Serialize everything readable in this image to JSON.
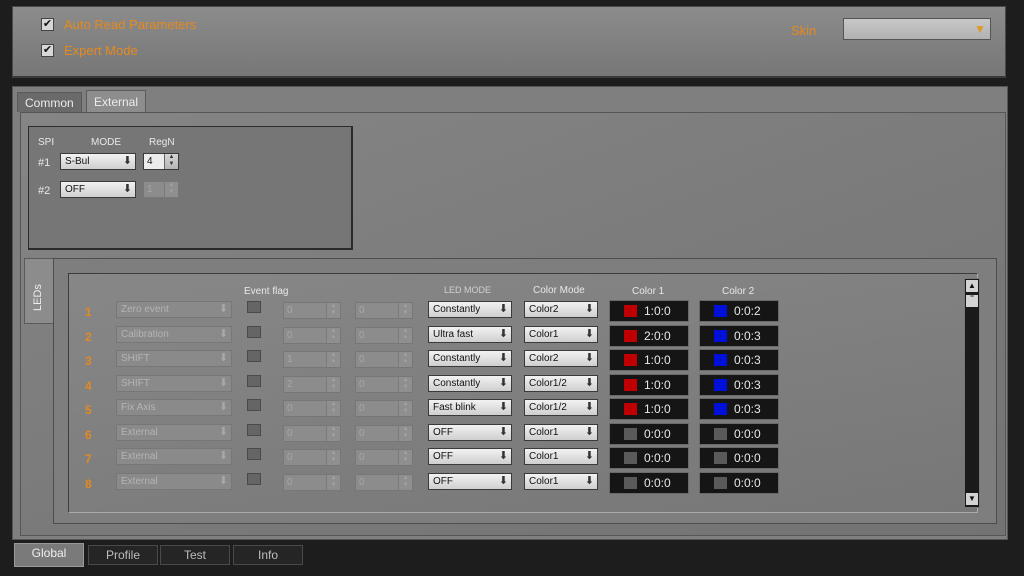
{
  "options": {
    "auto_read": {
      "label": "Auto Read Parameters",
      "checked": true
    },
    "expert_mode": {
      "label": "Expert Mode",
      "checked": true
    }
  },
  "skin": {
    "label": "Skin",
    "value": ""
  },
  "tabs": [
    {
      "label": "Common",
      "active": false
    },
    {
      "label": "External",
      "active": true
    }
  ],
  "spi": {
    "headers": {
      "spi": "SPI",
      "mode": "MODE",
      "regn": "RegN"
    },
    "rows": [
      {
        "label": "#1",
        "mode": "S-Bul",
        "regn": "4",
        "enabled": true
      },
      {
        "label": "#2",
        "mode": "OFF",
        "regn": "1",
        "enabled": false
      }
    ]
  },
  "leds": {
    "side_tab": "LEDs",
    "headers": {
      "event_flag": "Event flag",
      "led_mode": "LED MODE",
      "color_mode": "Color Mode",
      "color1": "Color 1",
      "color2": "Color 2"
    },
    "rows": [
      {
        "num": "1",
        "event": "Zero event",
        "v1": "0",
        "v2": "0",
        "led_mode": "Constantly",
        "color_mode": "Color2",
        "c1": "1:0:0",
        "c1_hex": "#c00000",
        "c2": "0:0:2",
        "c2_hex": "#0010d8"
      },
      {
        "num": "2",
        "event": "Calibration",
        "v1": "0",
        "v2": "0",
        "led_mode": "Ultra fast",
        "color_mode": "Color1",
        "c1": "2:0:0",
        "c1_hex": "#c00000",
        "c2": "0:0:3",
        "c2_hex": "#0010d8"
      },
      {
        "num": "3",
        "event": "SHIFT",
        "v1": "1",
        "v2": "0",
        "led_mode": "Constantly",
        "color_mode": "Color2",
        "c1": "1:0:0",
        "c1_hex": "#c00000",
        "c2": "0:0:3",
        "c2_hex": "#0010d8"
      },
      {
        "num": "4",
        "event": "SHIFT",
        "v1": "2",
        "v2": "0",
        "led_mode": "Constantly",
        "color_mode": "Color1/2",
        "c1": "1:0:0",
        "c1_hex": "#c00000",
        "c2": "0:0:3",
        "c2_hex": "#0010d8"
      },
      {
        "num": "5",
        "event": "Fix Axis",
        "v1": "0",
        "v2": "0",
        "led_mode": "Fast blink",
        "color_mode": "Color1/2",
        "c1": "1:0:0",
        "c1_hex": "#c00000",
        "c2": "0:0:3",
        "c2_hex": "#0010d8"
      },
      {
        "num": "6",
        "event": "External",
        "v1": "0",
        "v2": "0",
        "led_mode": "OFF",
        "color_mode": "Color1",
        "c1": "0:0:0",
        "c1_hex": "#5a5a5a",
        "c2": "0:0:0",
        "c2_hex": "#5a5a5a"
      },
      {
        "num": "7",
        "event": "External",
        "v1": "0",
        "v2": "0",
        "led_mode": "OFF",
        "color_mode": "Color1",
        "c1": "0:0:0",
        "c1_hex": "#5a5a5a",
        "c2": "0:0:0",
        "c2_hex": "#5a5a5a"
      },
      {
        "num": "8",
        "event": "External",
        "v1": "0",
        "v2": "0",
        "led_mode": "OFF",
        "color_mode": "Color1",
        "c1": "0:0:0",
        "c1_hex": "#5a5a5a",
        "c2": "0:0:0",
        "c2_hex": "#5a5a5a"
      }
    ]
  },
  "bottom_tabs": [
    {
      "label": "Global",
      "active": true
    },
    {
      "label": "Profile",
      "active": false
    },
    {
      "label": "Test",
      "active": false
    },
    {
      "label": "Info",
      "active": false
    }
  ],
  "colors": {
    "accent": "#e58a1e",
    "panel": "#7f7f7f",
    "dark": "#1d1d1d"
  },
  "icons": {
    "dropdown": "chevron-down-icon",
    "checkbox": "check-icon",
    "spinner": "up-down-arrows-icon"
  }
}
